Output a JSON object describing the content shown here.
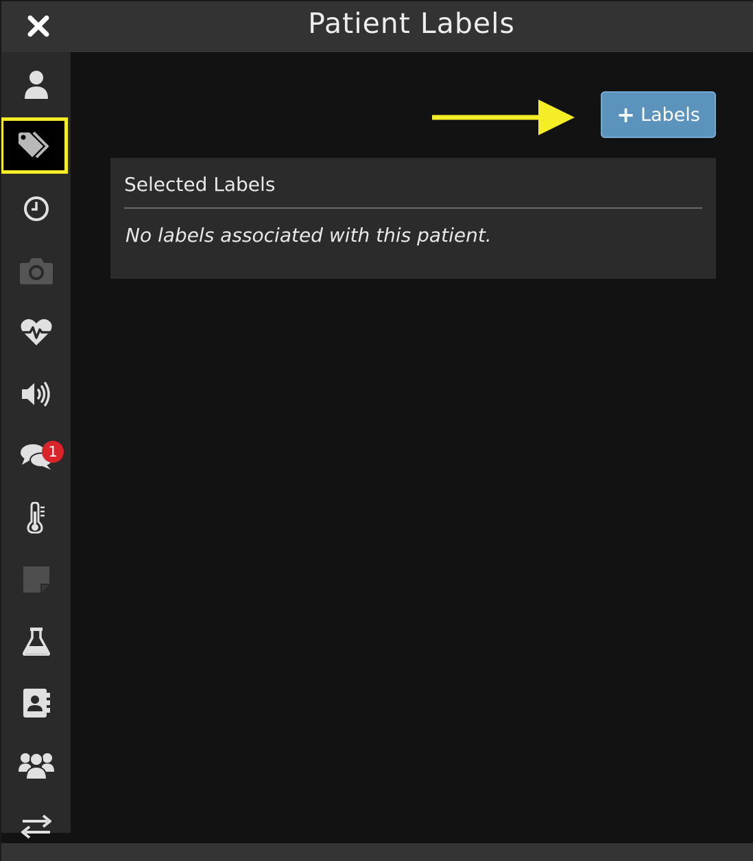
{
  "window": {
    "title": "Patient Labels",
    "close_icon": "close-icon"
  },
  "sidebar": {
    "items": [
      {
        "name": "patient",
        "icon": "user-icon"
      },
      {
        "name": "labels",
        "icon": "tags-icon",
        "active": true
      },
      {
        "name": "history",
        "icon": "clock-icon"
      },
      {
        "name": "photos",
        "icon": "camera-icon",
        "disabled": true
      },
      {
        "name": "vitals",
        "icon": "heartbeat-icon"
      },
      {
        "name": "announcements",
        "icon": "speaker-icon"
      },
      {
        "name": "messages",
        "icon": "chat-icon",
        "badge": "1"
      },
      {
        "name": "temperature",
        "icon": "thermometer-icon"
      },
      {
        "name": "notes",
        "icon": "sticky-note-icon",
        "disabled": true
      },
      {
        "name": "lab",
        "icon": "flask-icon"
      },
      {
        "name": "contacts",
        "icon": "address-book-icon"
      },
      {
        "name": "care-team",
        "icon": "users-icon"
      },
      {
        "name": "transfer",
        "icon": "exchange-icon"
      }
    ]
  },
  "toolbar": {
    "add_labels_plus": "+",
    "add_labels_text": "Labels"
  },
  "panel": {
    "heading": "Selected Labels",
    "empty_message": "No labels associated with this patient."
  },
  "colors": {
    "accent_button": "#5b93bd",
    "highlight": "#f5ee27",
    "badge": "#d9252a",
    "icon": "#e0e0e0",
    "icon_disabled": "#555555"
  }
}
